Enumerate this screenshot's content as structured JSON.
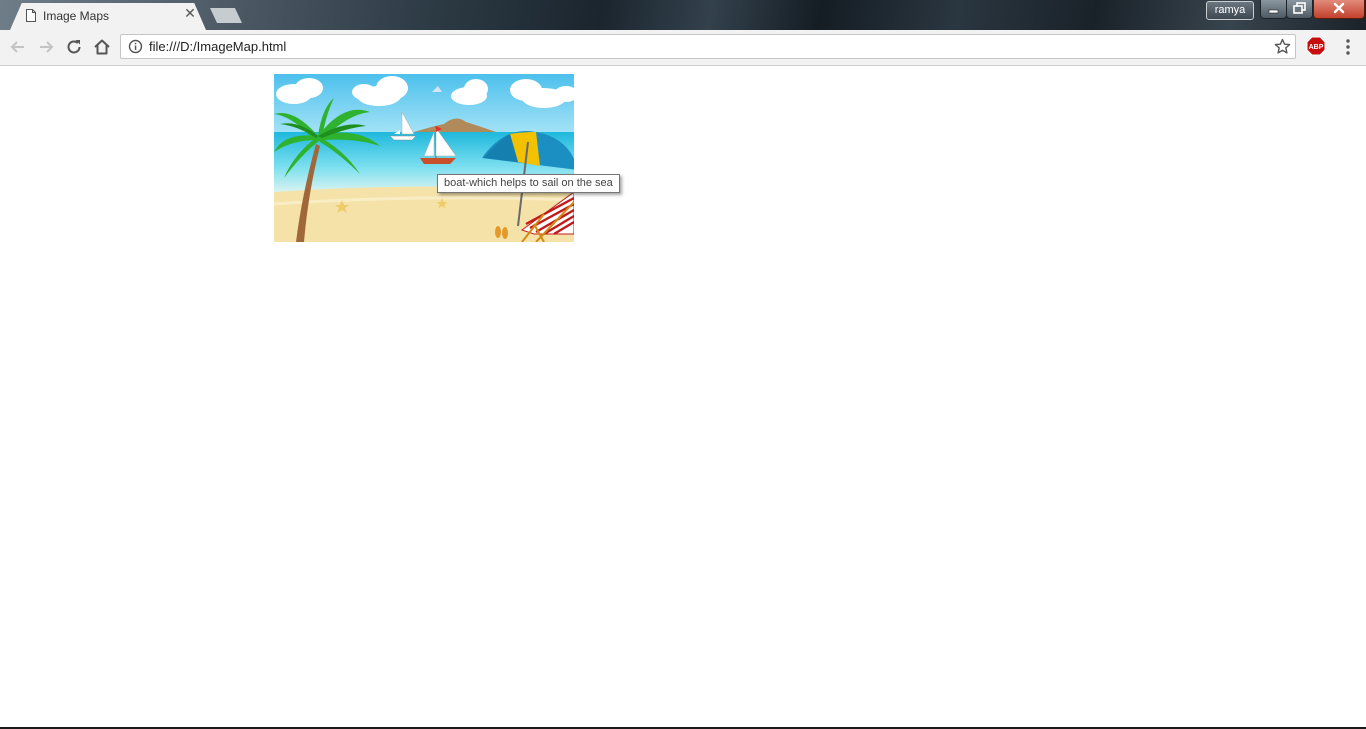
{
  "tab": {
    "title": "Image Maps",
    "close_glyph": "✕"
  },
  "titlebar": {
    "profile_name": "ramya"
  },
  "address_bar": {
    "url": "file:///D:/ImageMap.html"
  },
  "extensions": {
    "abp_label": "ABP"
  },
  "page": {
    "image_alt": "Beach scene with palm tree, sailboats, umbrella and deck chair",
    "tooltip": "boat-which helps to sail on the sea"
  },
  "icons": {
    "back": "arrow-left-icon",
    "forward": "arrow-right-icon",
    "reload": "reload-icon",
    "home": "home-icon",
    "info": "info-icon",
    "star": "star-icon",
    "menu": "kebab-menu-icon"
  },
  "colors": {
    "sky": "#5fc8ee",
    "sea": "#27c3e3",
    "sand": "#f5e2a8",
    "palm": "#2fb22d",
    "abp_red": "#c70d0d"
  }
}
